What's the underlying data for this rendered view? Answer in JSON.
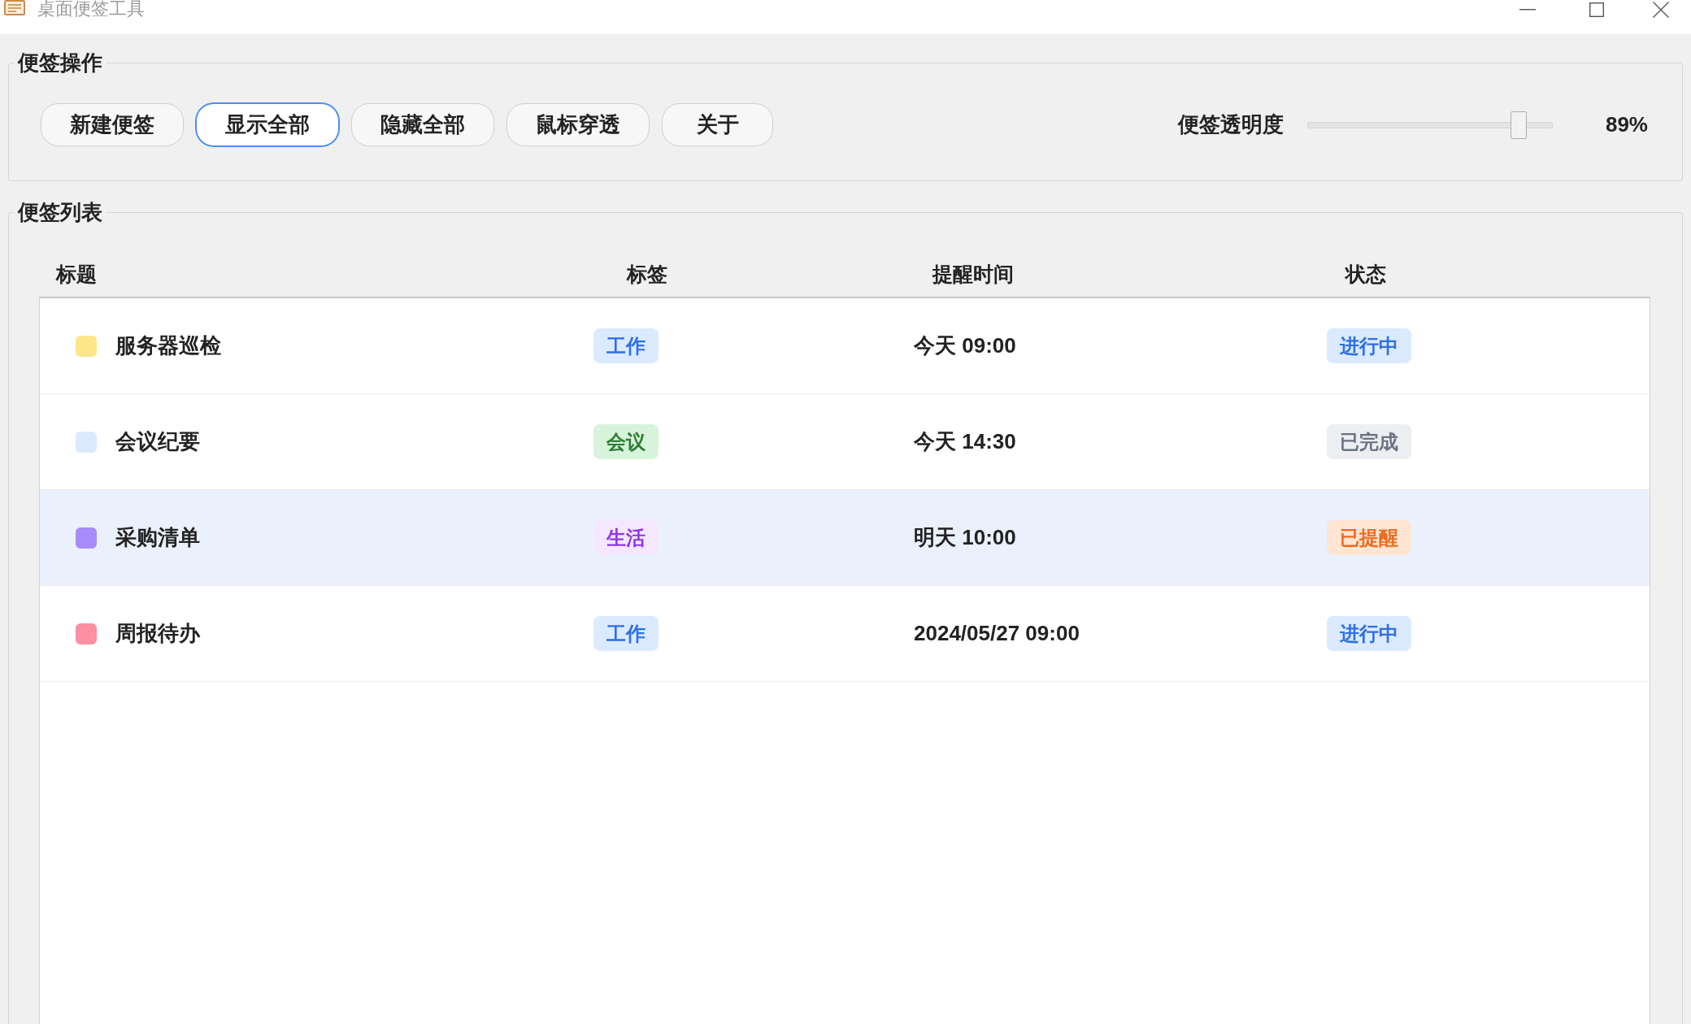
{
  "window": {
    "title": "桌面便签工具"
  },
  "actions_group": {
    "title": "便签操作",
    "buttons": [
      {
        "label": "新建便签",
        "focused": false
      },
      {
        "label": "显示全部",
        "focused": true
      },
      {
        "label": "隐藏全部",
        "focused": false
      },
      {
        "label": "鼠标穿透",
        "focused": false
      },
      {
        "label": "关于",
        "focused": false
      }
    ],
    "opacity": {
      "label": "便签透明度",
      "level": 0.89,
      "reading": "89%"
    }
  },
  "notes_group": {
    "title": "便签列表",
    "table": {
      "columns": [
        "标题",
        "标签",
        "提醒时间",
        "状态"
      ],
      "rows": [
        {
          "title": "服务器巡检",
          "color": "#fde68a",
          "tag": {
            "label": "工作",
            "kind": "work"
          },
          "reminder": "今天 09:00",
          "status": {
            "label": "进行中",
            "kind": "active"
          },
          "selected": false
        },
        {
          "title": "会议纪要",
          "color": "#dbeafe",
          "tag": {
            "label": "会议",
            "kind": "meeting"
          },
          "reminder": "今天 14:30",
          "status": {
            "label": "已完成",
            "kind": "done"
          },
          "selected": false
        },
        {
          "title": "采购清单",
          "color": "#a78bfa",
          "tag": {
            "label": "生活",
            "kind": "life"
          },
          "reminder": "明天 10:00",
          "status": {
            "label": "已提醒",
            "kind": "reminded"
          },
          "selected": true
        },
        {
          "title": "周报待办",
          "color": "#fb8fa3",
          "tag": {
            "label": "工作",
            "kind": "work"
          },
          "reminder": "2024/05/27 09:00",
          "status": {
            "label": "进行中",
            "kind": "active"
          },
          "selected": false
        }
      ]
    }
  }
}
